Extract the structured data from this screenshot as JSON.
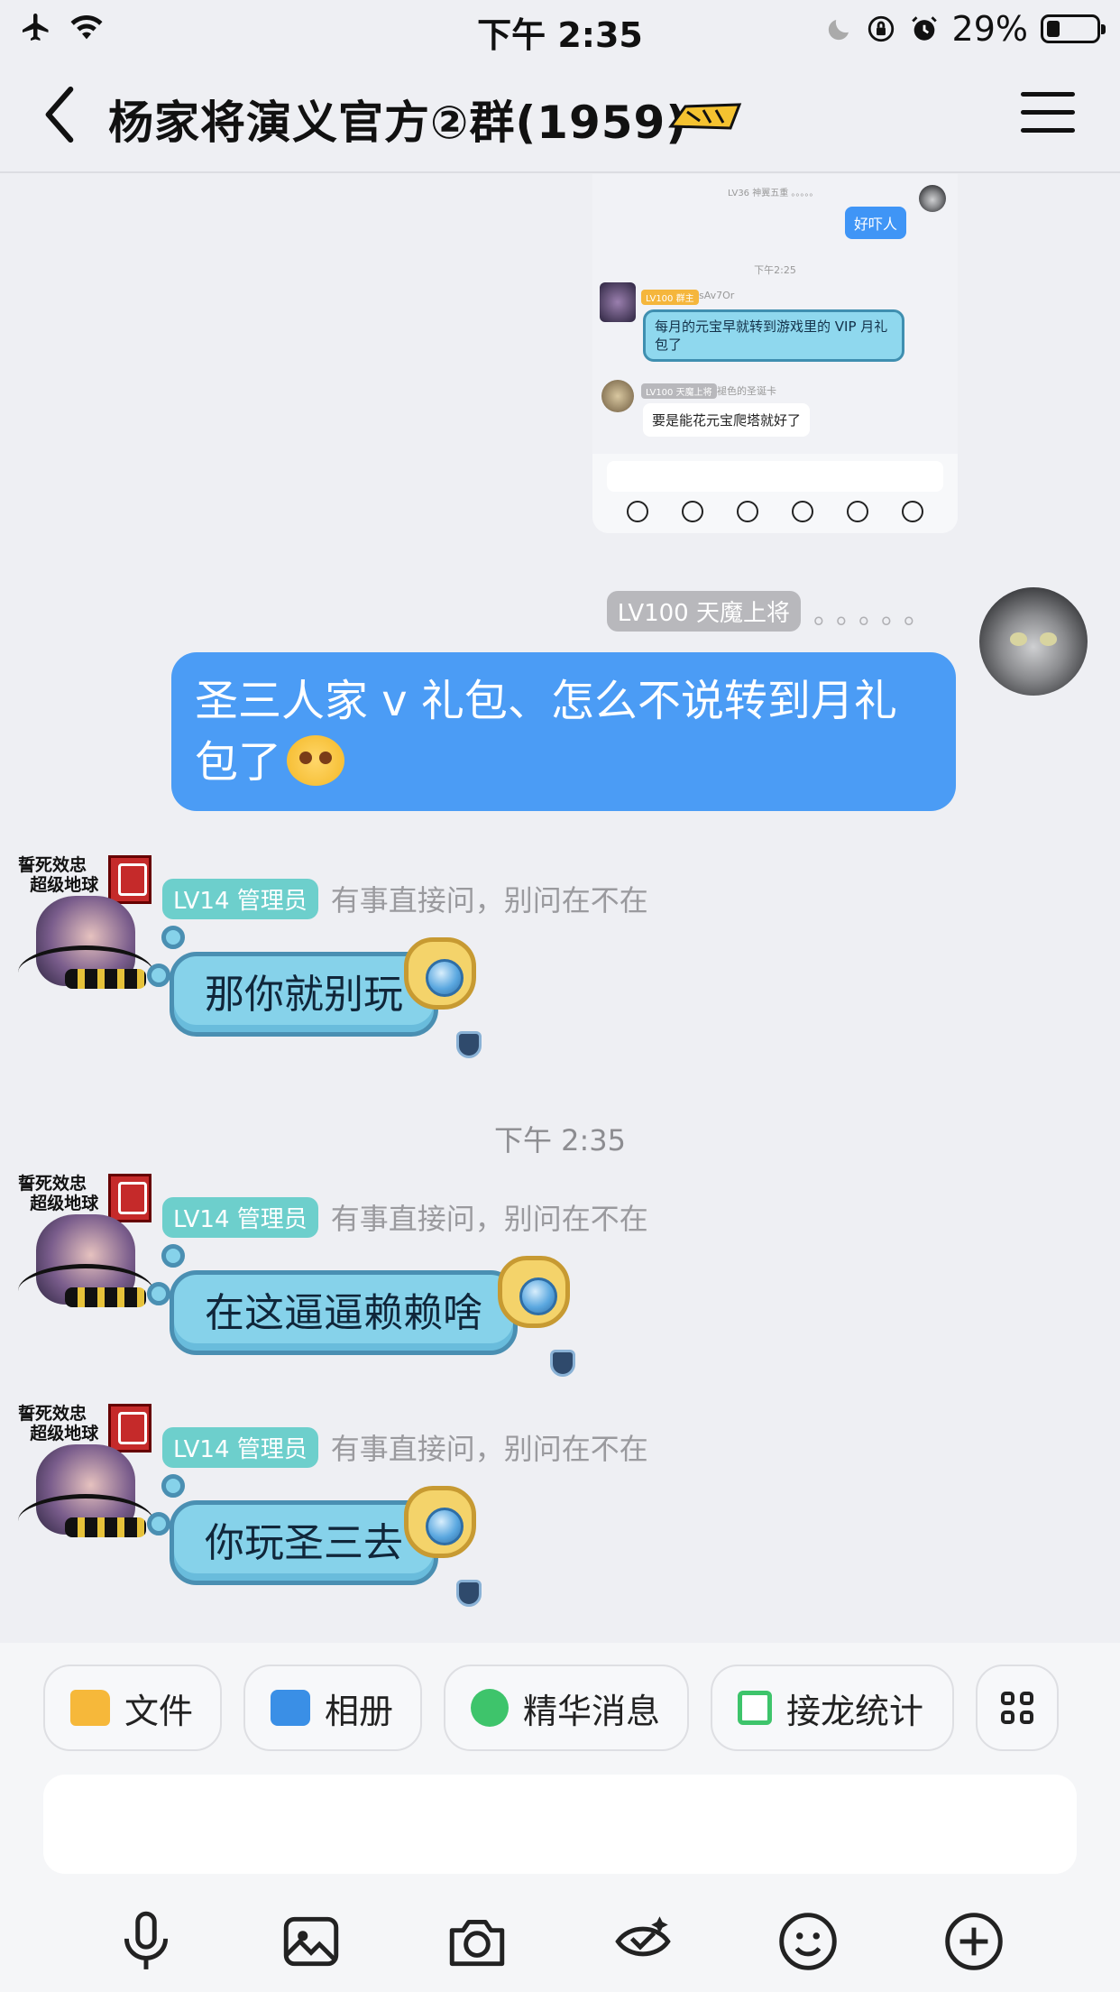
{
  "status_bar": {
    "time": "下午 2:35",
    "battery": "29%"
  },
  "nav": {
    "title": "杨家将演义官方②群(1959)"
  },
  "shared_screenshot": {
    "my_meta": "LV36 神翼五重 。。。。。",
    "my_message": "好吓人",
    "timestamp": "下午2:25",
    "user1_tag": "LV100 群主",
    "user1_name": "sAv7Or",
    "user1_message": "每月的元宝早就转到游戏里的 VIP 月礼包了",
    "user2_tag": "LV100 天魔上将",
    "user2_name": "褪色的圣诞卡",
    "user2_message": "要是能花元宝爬塔就好了"
  },
  "messages": {
    "me": {
      "badge": "LV100 天魔上将",
      "suffix": "。。。。。",
      "text": "圣三人家 v 礼包、怎么不说转到月礼包了"
    },
    "admin_sticker_caption_1": "誓死效忠",
    "admin_sticker_caption_2": "超级地球",
    "admin_badge": "LV14 管理员",
    "admin_name": "有事直接问，别问在不在",
    "msg1": "那你就别玩",
    "timestamp": "下午 2:35",
    "msg2": "在这逼逼赖赖啥",
    "msg3": "你玩圣三去"
  },
  "shortcuts": {
    "file": "文件",
    "album": "相册",
    "essence": "精华消息",
    "relay": "接龙统计"
  },
  "colors": {
    "my_bubble": "#4b9cf5",
    "admin_badge": "#6dcfcc",
    "accent_blue": "#3a8fe6"
  }
}
